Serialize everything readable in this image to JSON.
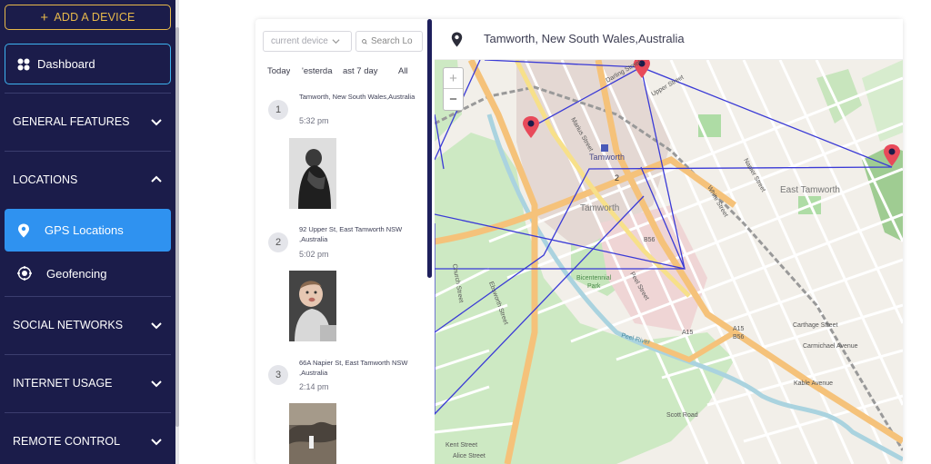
{
  "sidebar": {
    "add_device": "ADD A DEVICE",
    "dashboard": "Dashboard",
    "sections": {
      "general": "GENERAL FEATURES",
      "locations": "LOCATIONS",
      "social": "SOCIAL NETWORKS",
      "internet": "INTERNET USAGE",
      "remote": "REMOTE CONTROL"
    },
    "gps_locations": "GPS Locations",
    "geofencing": "Geofencing"
  },
  "filters": {
    "device_select": "current device",
    "search_placeholder": "Search Lo",
    "tabs": [
      "Today",
      "'esterda",
      "ast 7 day",
      "All"
    ]
  },
  "entries": [
    {
      "num": "1",
      "address": "Tamworth, New South Wales,Australia",
      "time": "5:32 pm"
    },
    {
      "num": "2",
      "address": "92 Upper St,  East Tamworth NSW ,Australia",
      "time": "5:02 pm"
    },
    {
      "num": "3",
      "address": "66A Napier St,  East Tamworth NSW ,Australia",
      "time": "2:14 pm"
    }
  ],
  "map": {
    "title": "Tamworth, New South Wales,Australia",
    "zoom_in": "+",
    "zoom_out": "−",
    "labels": {
      "tamworth": "Tamworth",
      "tamworth_center": "Tamworth",
      "east_tamworth": "East Tamworth",
      "bicentennial": "Bicentennial",
      "park": "Park",
      "peel_river": "Peel River",
      "marius": "Marius Street",
      "peel_street": "Peel Street",
      "ebsworth": "Ebsworth Street",
      "b56": "B56",
      "a15": "A15",
      "a15b": "A15",
      "b56b": "B56",
      "scott_road": "Scott Road",
      "kent_street": "Kent Street",
      "alice_street": "Alice Street",
      "napier": "Napier Street",
      "white_street": "White Street",
      "carthage": "Carthage Street",
      "carmichael": "Carmichael Avenue",
      "kable": "Kable Avenue",
      "upper_street": "Upper Street",
      "darling_street": "Darling Street",
      "church_street": "Church Street",
      "two": "2"
    }
  },
  "colors": {
    "sidebar_bg": "#1b1c4a",
    "accent_blue": "#2f92f0",
    "accent_gold": "#e7b94a",
    "route_line": "#3a3ad6",
    "marker_red": "#e84a5a"
  }
}
